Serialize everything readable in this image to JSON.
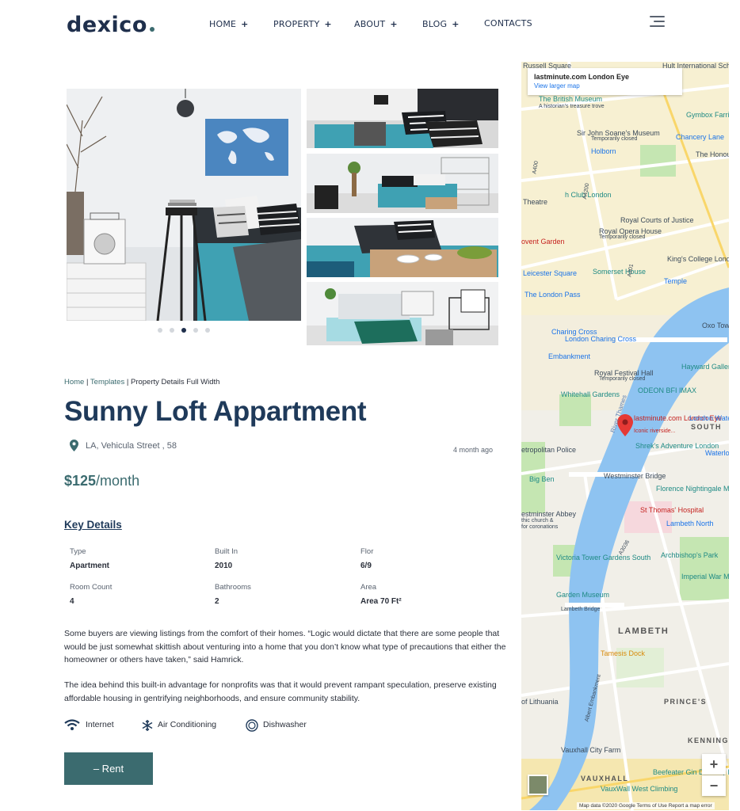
{
  "header": {
    "logo_text": "dexico",
    "nav": [
      {
        "label": "HOME",
        "has_submenu": true
      },
      {
        "label": "PROPERTY",
        "has_submenu": true
      },
      {
        "label": "ABOUT",
        "has_submenu": true
      },
      {
        "label": "BLOG",
        "has_submenu": true
      },
      {
        "label": "CONTACTS",
        "has_submenu": false
      }
    ],
    "submenu_symbol": "+"
  },
  "gallery": {
    "main_image": "bedroom-world-map-photo",
    "thumbnails": [
      "bedroom-thumb-1",
      "bedroom-thumb-2",
      "bedroom-thumb-3",
      "bedroom-thumb-4"
    ],
    "slide_count": 5,
    "active_slide": 3
  },
  "map": {
    "card_title": "lastminute.com London Eye",
    "card_link": "View larger map",
    "zoom_in": "+",
    "zoom_out": "−",
    "footer": "Map data ©2020 Google   Terms of Use   Report a map error",
    "labels": [
      "Russell Square",
      "Hult International School",
      "The British Museum",
      "A historian's treasure trove",
      "Gymbox Farringdon",
      "Sir John Soane's Museum",
      "Temporarily closed",
      "Chancery Lane",
      "Holborn",
      "The Honourable Society of",
      "h Club London",
      "Theatre",
      "Royal Courts of Justice",
      "Royal Opera House",
      "Temporarily closed",
      "ovent Garden",
      "King's College London",
      "Leicester Square",
      "Somerset House",
      "Temple",
      "The London Pass",
      "Oxo Tower",
      "Charing Cross",
      "London Charing Cross",
      "Embankment",
      "Hayward Gallery",
      "Royal Festival Hall",
      "Temporarily closed",
      "Whitehall Gardens",
      "ODEON BFI IMAX",
      "lastminute.com London Eye",
      "Iconic riverside...",
      "London Waterloo",
      "SOUTH",
      "Shrek's Adventure London",
      "Waterloo",
      "etropolitan Police",
      "Big Ben",
      "Westminster Bridge",
      "Florence Nightingale Museum",
      "St Thomas' Hospital",
      "Lambeth North",
      "estminster Abbey",
      "thic church &",
      "for coronations",
      "Archbishop's Park",
      "Victoria Tower Gardens South",
      "Imperial War M",
      "Garden Museum",
      "Lambeth Bridge",
      "LAMBETH",
      "Tamesis Dock",
      "of Lithuania",
      "PRINCE'S",
      "Vauxhall City Farm",
      "KENNING",
      "VAUXHALL",
      "Beefeater Gin Distillery London",
      "VauxWall West Climbing",
      "River Thames",
      "Albert Embankment",
      "A3036",
      "A301",
      "A400",
      "A4200"
    ]
  },
  "breadcrumb": {
    "home": "Home",
    "sep": "|",
    "templates": "Templates",
    "current": "Property Details Full Width"
  },
  "property": {
    "title": "Sunny Loft Appartment",
    "address": "LA, Vehicula Street , 58",
    "posted": "4 month ago",
    "price": "$125",
    "price_period": "/month"
  },
  "key_details": {
    "title": "Key Details",
    "items": [
      {
        "label": "Type",
        "value": "Apartment"
      },
      {
        "label": "Built In",
        "value": "2010"
      },
      {
        "label": "Flor",
        "value": "6/9"
      },
      {
        "label": "Room Count",
        "value": "4"
      },
      {
        "label": "Bathrooms",
        "value": "2"
      },
      {
        "label": "Area",
        "value": "Area 70 Ft²"
      }
    ]
  },
  "description": [
    "Some buyers are viewing listings from the comfort of their homes. “Logic would dictate that there are some people that would be just somewhat skittish about venturing into a home that you don’t know what type of precautions that either the homeowner or others have taken,” said Hamrick.",
    "The idea behind this built-in advantage for nonprofits was that it would prevent rampant speculation, preserve existing affordable housing in gentrifying neighborhoods, and ensure community stability."
  ],
  "amenities": [
    {
      "label": "Internet",
      "icon": "wifi-icon"
    },
    {
      "label": "Air Conditioning",
      "icon": "snowflake-icon"
    },
    {
      "label": "Dishwasher",
      "icon": "dishwasher-icon"
    }
  ],
  "action": {
    "rent_label": "– Rent"
  },
  "colors": {
    "brand_navy": "#1f2f4c",
    "accent_teal": "#3b6b6f",
    "map_water": "#8ec3f1",
    "map_park": "#c5e6b2",
    "map_pin": "#e53935"
  }
}
